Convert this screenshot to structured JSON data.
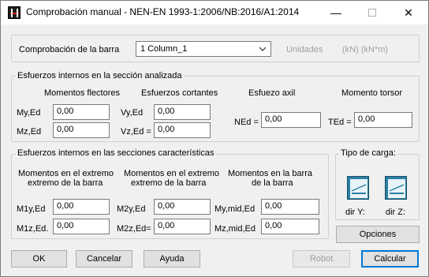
{
  "window": {
    "title": "Comprobación manual - NEN-EN 1993-1:2006/NB:2016/A1:2014",
    "min_glyph": "—",
    "close_glyph": "✕"
  },
  "check": {
    "bar_label": "Comprobación de la barra",
    "bar_value": "1  Column_1",
    "units_label": "Unidades",
    "units_value": "(kN) (kN*m)"
  },
  "section": {
    "title": "Esfuerzos internos en la sección analizada",
    "bending_title": "Momentos flectores",
    "shear_title": "Esfuerzos cortantes",
    "axial_title": "Esfuezo axil",
    "torsion_title": "Momento torsor",
    "my_label": "My,Ed",
    "my_value": "0,00",
    "mz_label": "Mz,Ed",
    "mz_value": "0,00",
    "vy_label": "Vy,Ed",
    "vy_value": "0,00",
    "vz_label": "Vz,Ed =",
    "vz_value": "0,00",
    "ned_label": "NEd =",
    "ned_value": "0,00",
    "ted_label": "TEd =",
    "ted_value": "0,00"
  },
  "characteristic": {
    "title": "Esfuerzos internos en las secciones características",
    "col1_title_1": "Momentos en el extremo",
    "col1_title_2": "extremo de la barra",
    "col2_title_1": "Momentos en el extremo",
    "col2_title_2": "extremo de la barra",
    "col3_title_1": "Momentos en la barra",
    "col3_title_2": "de la barra",
    "m1y_label": "M1y,Ed",
    "m1y_value": "0,00",
    "m1z_label": "M1z,Ed.",
    "m1z_value": "0,00",
    "m2y_label": "M2y,Ed",
    "m2y_value": "0,00",
    "m2z_label": "M2z,Ed=",
    "m2z_value": "0,00",
    "mymid_label": "My,mid,Ed",
    "mymid_value": "0,00",
    "mzmid_label": "Mz,mid,Ed",
    "mzmid_value": "0,00"
  },
  "load": {
    "title": "Tipo de carga:",
    "dir_y_label": "dir Y:",
    "dir_z_label": "dir Z:",
    "options_label": "Opciones"
  },
  "buttons": {
    "ok": "OK",
    "cancel": "Cancelar",
    "help": "Ayuda",
    "robot": "Robot",
    "calculate": "Calcular"
  },
  "colors": {
    "accent": "#0078d7",
    "icon_blue": "#2b7fa3",
    "disabled_text": "#a0a0a0"
  }
}
